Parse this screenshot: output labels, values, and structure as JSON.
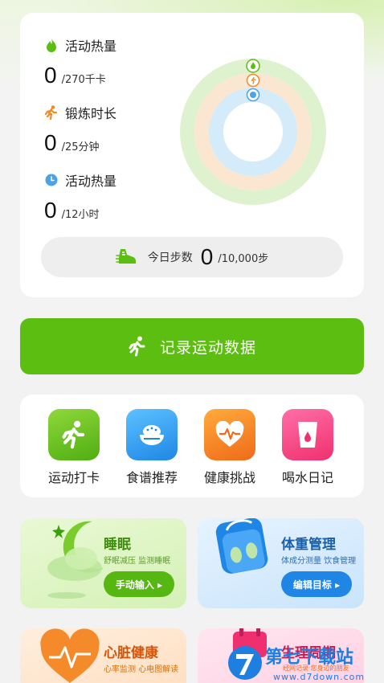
{
  "stats": [
    {
      "label": "活动热量",
      "value": "0",
      "target": "/270千卡",
      "icon": "flame-icon",
      "color": "#5cbe10"
    },
    {
      "label": "锻炼时长",
      "value": "0",
      "target": "/25分钟",
      "icon": "running-icon",
      "color": "#f08a2a"
    },
    {
      "label": "活动热量",
      "value": "0",
      "target": "/12小时",
      "icon": "clock-icon",
      "color": "#4aa3e8"
    }
  ],
  "steps": {
    "label": "今日步数",
    "value": "0",
    "target": "/10,000步"
  },
  "record_button": {
    "label": "记录运动数据"
  },
  "shortcuts": [
    {
      "label": "运动打卡",
      "icon": "running-icon"
    },
    {
      "label": "食谱推荐",
      "icon": "rice-bowl-icon"
    },
    {
      "label": "健康挑战",
      "icon": "heart-pulse-icon"
    },
    {
      "label": "喝水日记",
      "icon": "water-cup-icon"
    }
  ],
  "features": [
    {
      "title": "睡眠",
      "subtitle": "舒眠减压 监测睡眠",
      "button": "手动输入 ▸"
    },
    {
      "title": "体重管理",
      "subtitle": "体成分测量 饮食管理",
      "button": "编辑目标 ▸"
    },
    {
      "title": "心脏健康",
      "subtitle": "心率监测 心电图解读"
    },
    {
      "title": "生理周期"
    }
  ],
  "watermark": {
    "brand": "第七下载站",
    "tagline": "经网记录·您身边的朋友",
    "url": "www.d7down.com"
  },
  "colors": {
    "accent_green": "#5cbe10",
    "ring_outer": "#dff2cf",
    "ring_middle": "#fbe6d2",
    "ring_inner": "#d4ebfa"
  }
}
